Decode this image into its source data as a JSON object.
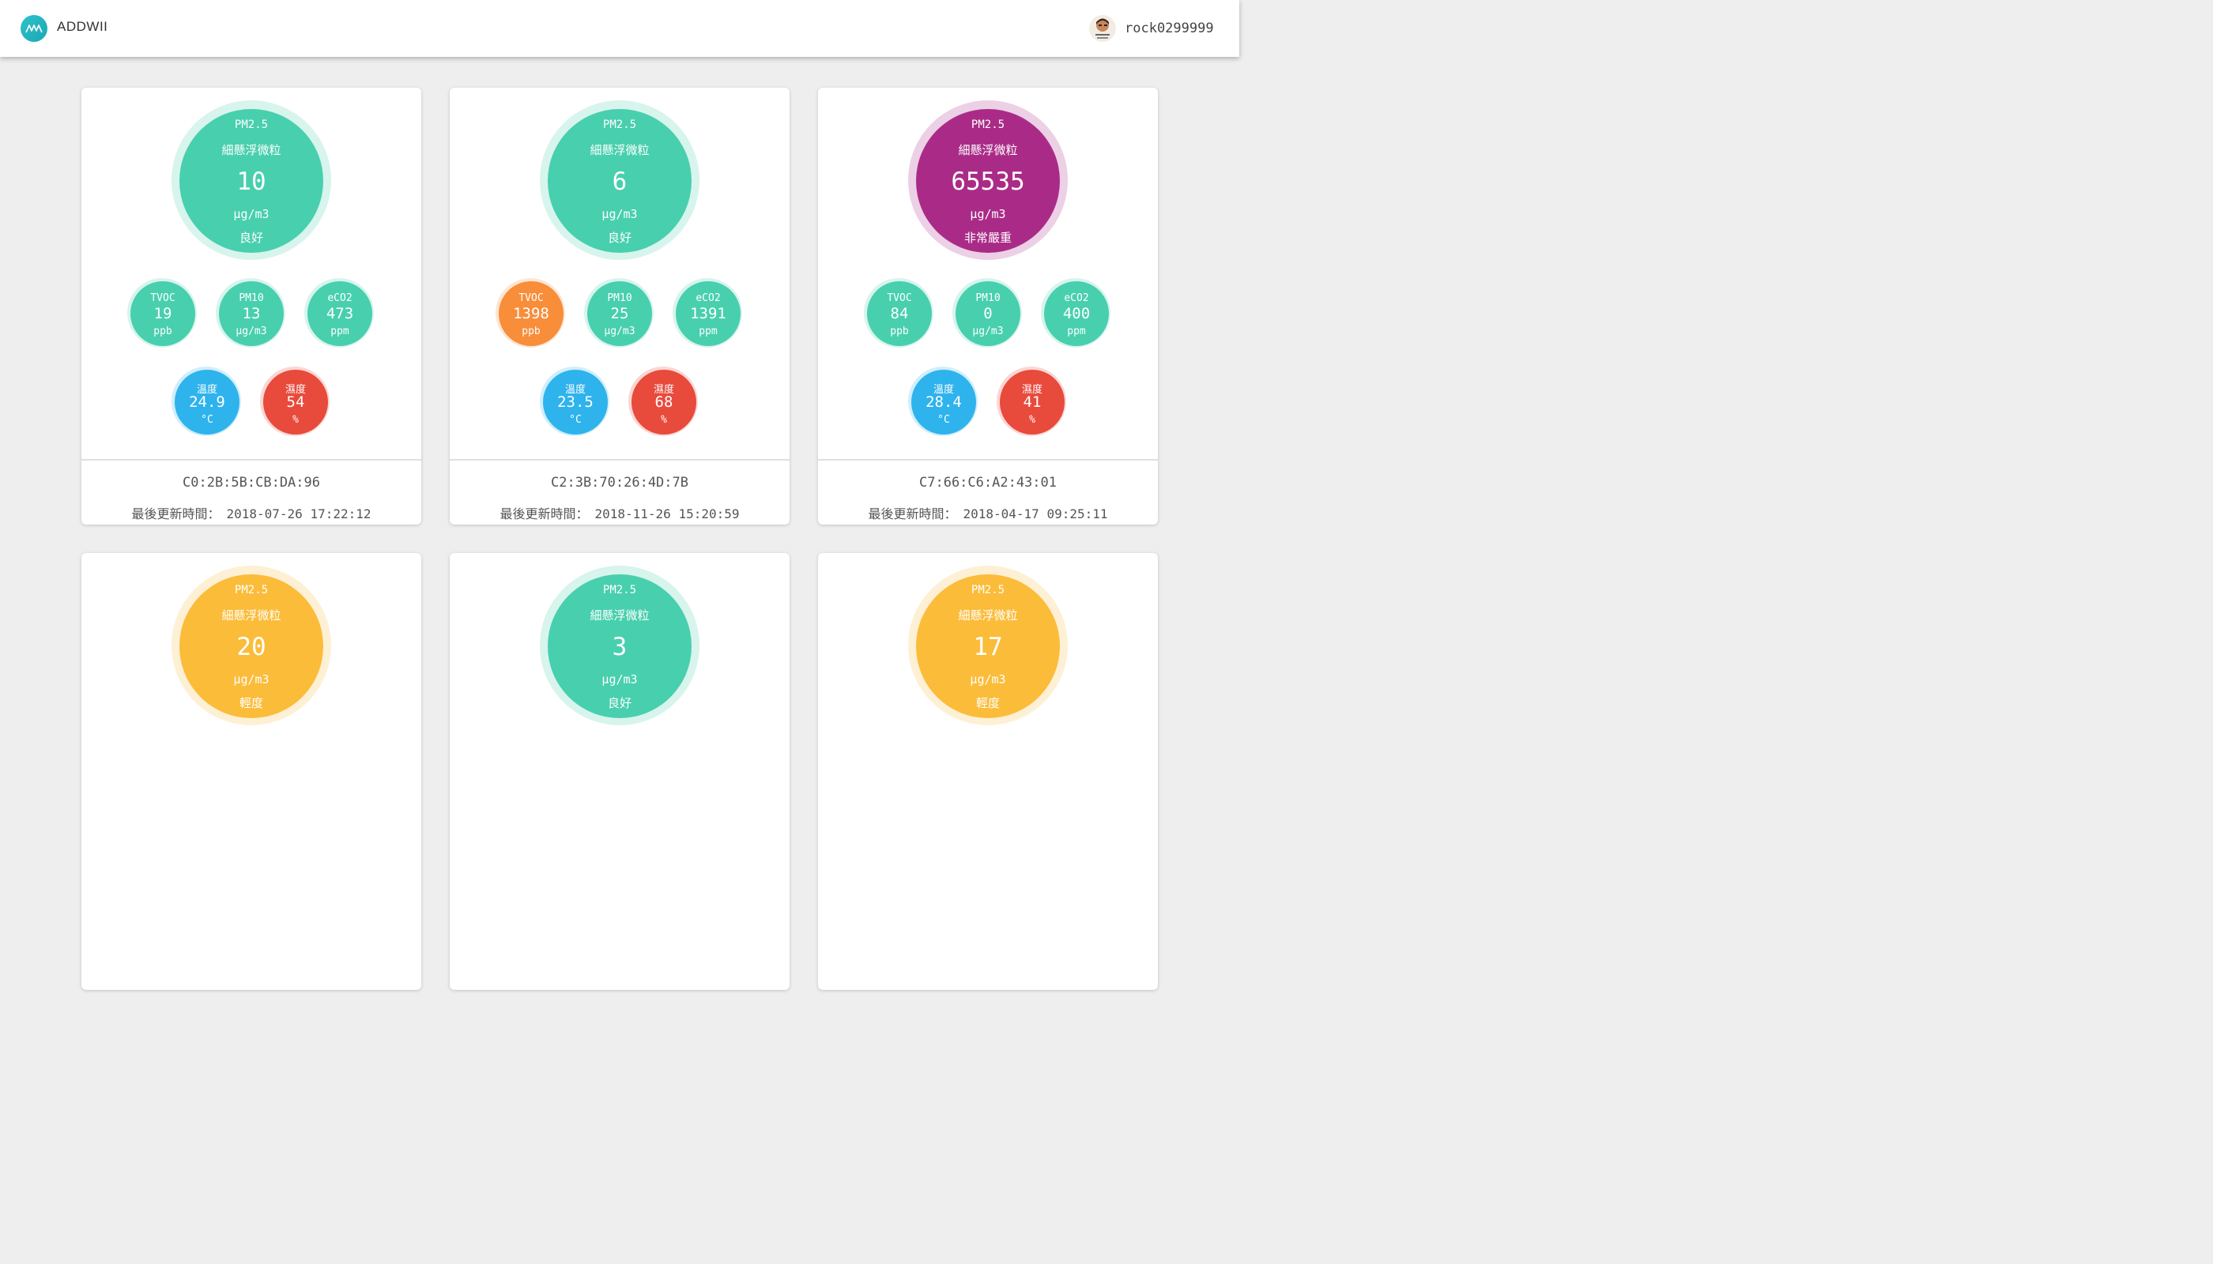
{
  "header": {
    "brand": "ADDWII",
    "username": "rock0299999"
  },
  "colors": {
    "good": "#48cfae",
    "moderate": "#fbbc3a",
    "severe": "#aa2b87",
    "warning": "#f88d3a",
    "temperature": "#2eb3ed",
    "humidity": "#e84a3c",
    "brand": "#1fb3bf"
  },
  "icons": {
    "logo": "addwii-logo-icon",
    "avatar": "user-avatar"
  },
  "cards": [
    {
      "pm25": {
        "label": "PM2.5",
        "name": "細懸浮微粒",
        "value": "10",
        "unit": "µg/m3",
        "status": "良好",
        "level": "good"
      },
      "tvoc": {
        "label": "TVOC",
        "value": "19",
        "unit": "ppb",
        "level": "good"
      },
      "pm10": {
        "label": "PM10",
        "value": "13",
        "unit": "µg/m3",
        "level": "good"
      },
      "eco2": {
        "label": "eCO2",
        "value": "473",
        "unit": "ppm",
        "level": "good"
      },
      "temp": {
        "label": "溫度",
        "value": "24.9",
        "unit": "°C",
        "level": "temperature"
      },
      "humi": {
        "label": "濕度",
        "value": "54",
        "unit": "%",
        "level": "humidity"
      },
      "mac": "C0:2B:5B:CB:DA:96",
      "updated_label": "最後更新時間：",
      "updated_time": "2018-07-26 17:22:12"
    },
    {
      "pm25": {
        "label": "PM2.5",
        "name": "細懸浮微粒",
        "value": "6",
        "unit": "µg/m3",
        "status": "良好",
        "level": "good"
      },
      "tvoc": {
        "label": "TVOC",
        "value": "1398",
        "unit": "ppb",
        "level": "warning"
      },
      "pm10": {
        "label": "PM10",
        "value": "25",
        "unit": "µg/m3",
        "level": "good"
      },
      "eco2": {
        "label": "eCO2",
        "value": "1391",
        "unit": "ppm",
        "level": "good"
      },
      "temp": {
        "label": "溫度",
        "value": "23.5",
        "unit": "°C",
        "level": "temperature"
      },
      "humi": {
        "label": "濕度",
        "value": "68",
        "unit": "%",
        "level": "humidity"
      },
      "mac": "C2:3B:70:26:4D:7B",
      "updated_label": "最後更新時間：",
      "updated_time": "2018-11-26 15:20:59"
    },
    {
      "pm25": {
        "label": "PM2.5",
        "name": "細懸浮微粒",
        "value": "65535",
        "unit": "µg/m3",
        "status": "非常嚴重",
        "level": "severe"
      },
      "tvoc": {
        "label": "TVOC",
        "value": "84",
        "unit": "ppb",
        "level": "good"
      },
      "pm10": {
        "label": "PM10",
        "value": "0",
        "unit": "µg/m3",
        "level": "good"
      },
      "eco2": {
        "label": "eCO2",
        "value": "400",
        "unit": "ppm",
        "level": "good"
      },
      "temp": {
        "label": "溫度",
        "value": "28.4",
        "unit": "°C",
        "level": "temperature"
      },
      "humi": {
        "label": "濕度",
        "value": "41",
        "unit": "%",
        "level": "humidity"
      },
      "mac": "C7:66:C6:A2:43:01",
      "updated_label": "最後更新時間：",
      "updated_time": "2018-04-17 09:25:11"
    },
    {
      "pm25": {
        "label": "PM2.5",
        "name": "細懸浮微粒",
        "value": "20",
        "unit": "µg/m3",
        "status": "輕度",
        "level": "moderate"
      }
    },
    {
      "pm25": {
        "label": "PM2.5",
        "name": "細懸浮微粒",
        "value": "3",
        "unit": "µg/m3",
        "status": "良好",
        "level": "good"
      }
    },
    {
      "pm25": {
        "label": "PM2.5",
        "name": "細懸浮微粒",
        "value": "17",
        "unit": "µg/m3",
        "status": "輕度",
        "level": "moderate"
      }
    }
  ]
}
